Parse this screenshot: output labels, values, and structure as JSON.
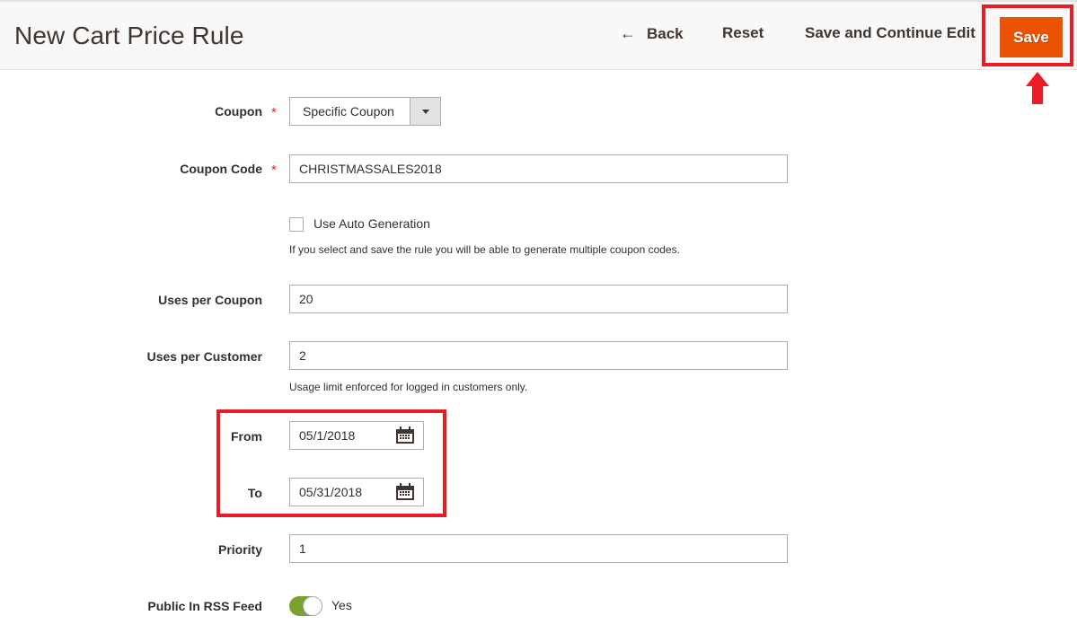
{
  "header": {
    "title": "New Cart Price Rule",
    "back_label": "Back",
    "reset_label": "Reset",
    "save_continue_label": "Save and Continue Edit",
    "save_label": "Save"
  },
  "form": {
    "coupon": {
      "label": "Coupon",
      "required_mark": "*",
      "selected": "Specific Coupon"
    },
    "coupon_code": {
      "label": "Coupon Code",
      "required_mark": "*",
      "value": "CHRISTMASSALES2018"
    },
    "auto_generation": {
      "label": "Use Auto Generation",
      "checked": false,
      "note": "If you select and save the rule you will be able to generate multiple coupon codes."
    },
    "uses_per_coupon": {
      "label": "Uses per Coupon",
      "value": "20"
    },
    "uses_per_customer": {
      "label": "Uses per Customer",
      "value": "2",
      "note": "Usage limit enforced for logged in customers only."
    },
    "from": {
      "label": "From",
      "value": "05/1/2018"
    },
    "to": {
      "label": "To",
      "value": "05/31/2018"
    },
    "priority": {
      "label": "Priority",
      "value": "1"
    },
    "rss_feed": {
      "label": "Public In RSS Feed",
      "enabled": true,
      "state_label": "Yes"
    }
  },
  "colors": {
    "primary_button": "#eb5202",
    "annotation": "#ed1c24",
    "toggle_on": "#79a22e",
    "required": "#e22626"
  },
  "icons": {
    "back": "arrow-left-icon",
    "select": "chevron-down-icon",
    "date": "calendar-icon"
  }
}
